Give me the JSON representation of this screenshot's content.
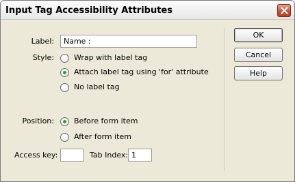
{
  "window": {
    "title": "Input Tag Accessibility Attributes"
  },
  "form": {
    "label_caption": "Label:",
    "label_value": "Name :",
    "style_caption": "Style:",
    "style_options": [
      "Wrap with label tag",
      "Attach label tag using 'for' attribute",
      "No label tag"
    ],
    "style_selected": "Attach label tag using 'for' attribute",
    "position_caption": "Position:",
    "position_options": [
      "Before form item",
      "After form item"
    ],
    "position_selected": "Before form item",
    "access_key_caption": "Access key:",
    "access_key_value": "",
    "tab_index_caption": "Tab Index:",
    "tab_index_value": "1"
  },
  "buttons": {
    "ok": "OK",
    "cancel": "Cancel",
    "help": "Help"
  },
  "colors": {
    "radio_selected": "#2aa12a",
    "close_button": "#c8563c"
  },
  "icons": {
    "close": "close-icon"
  }
}
